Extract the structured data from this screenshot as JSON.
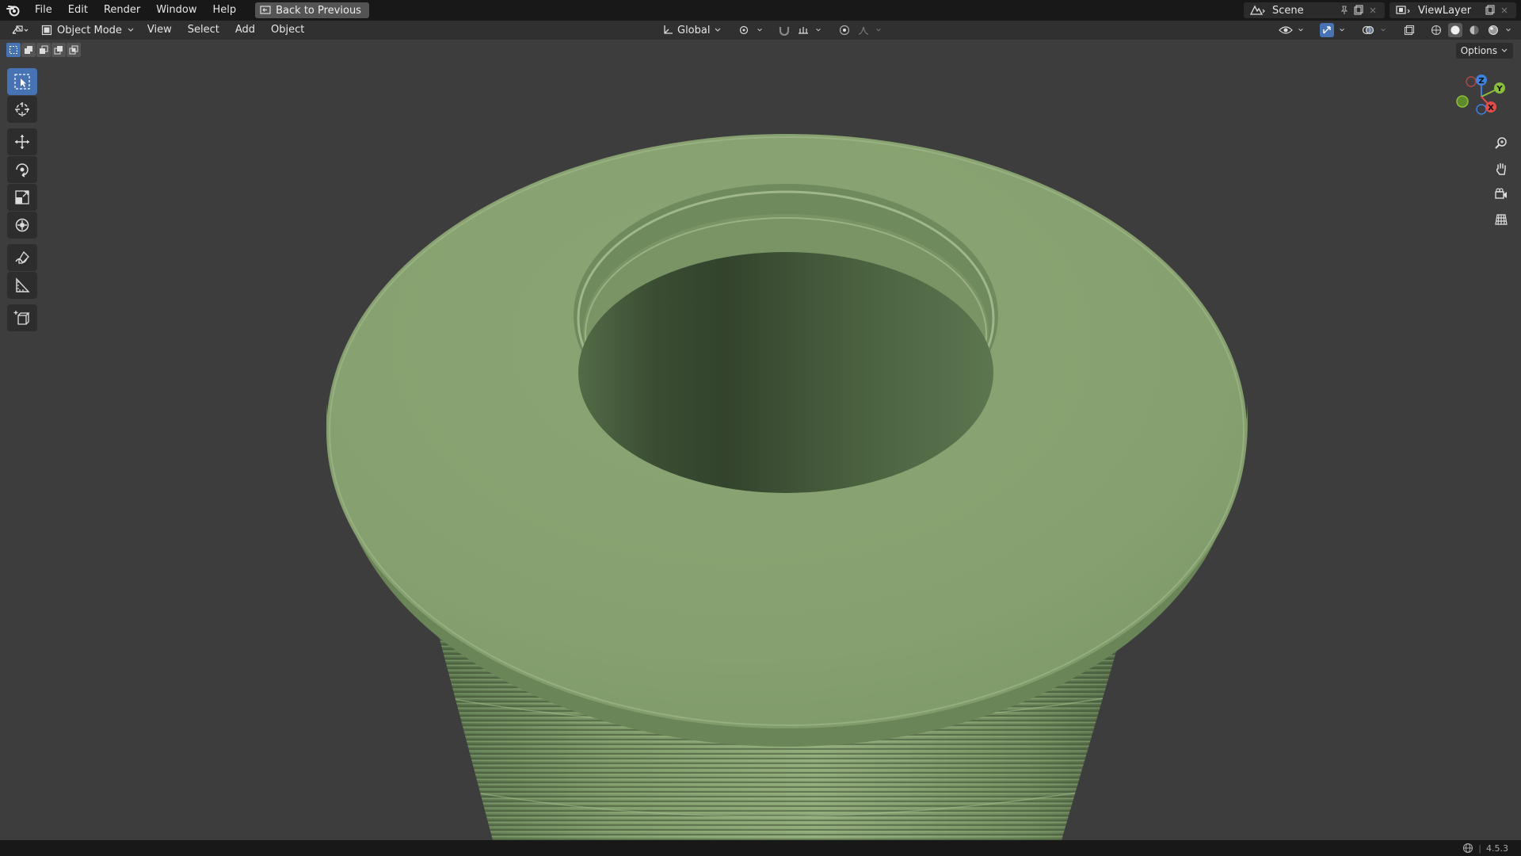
{
  "topbar": {
    "menus": [
      "File",
      "Edit",
      "Render",
      "Window",
      "Help"
    ],
    "back_button": "Back to Previous",
    "scene_name": "Scene",
    "view_layer_name": "ViewLayer"
  },
  "viewport_header": {
    "mode": "Object Mode",
    "menus": [
      "View",
      "Select",
      "Add",
      "Object"
    ],
    "transform_orientation": "Global",
    "options_label": "Options"
  },
  "gizmo": {
    "x_label": "X",
    "y_label": "Y",
    "z_label": "Z",
    "x_color": "#e14b4b",
    "y_color": "#8bbe3b",
    "z_color": "#3b82e1"
  },
  "object": {
    "color": "#86a06f",
    "shadow_color": "#3f5236"
  },
  "statusbar": {
    "version": "4.5.3"
  },
  "colors": {
    "accent": "#4772b3",
    "topbar_bg": "#181818",
    "header_bg": "#303030",
    "viewport_bg": "#3d3d3d"
  }
}
